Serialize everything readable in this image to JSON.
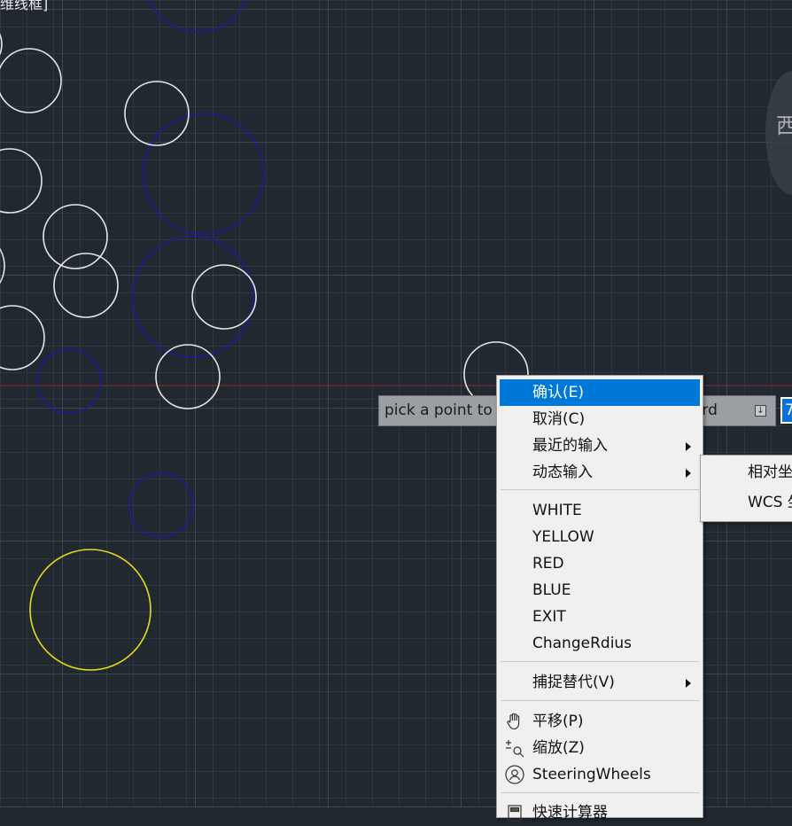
{
  "viewport": {
    "label": "维线框]",
    "viewcube_text": "西"
  },
  "prompt": {
    "text": "pick a point to",
    "tail": "ord",
    "coord_value": "7"
  },
  "colors": {
    "background": "#212830",
    "highlight": "#0078d7",
    "circle_white": "#e6e6e6",
    "circle_blue": "#1c1c9a",
    "circle_yellow": "#e6dc14",
    "crosshair": "#8a2b2b"
  },
  "context_menu": {
    "confirm": "确认(E)",
    "cancel": "取消(C)",
    "recent_input": "最近的输入",
    "dynamic_input": "动态输入",
    "white": "WHITE",
    "yellow": "YELLOW",
    "red": "RED",
    "blue": "BLUE",
    "exit": "EXIT",
    "change_radius": "ChangeRdius",
    "snap_override": "捕捉替代(V)",
    "pan": "平移(P)",
    "zoom": "缩放(Z)",
    "steering_wheels": "SteeringWheels",
    "partial_next": "快速计算器"
  },
  "submenu": {
    "relative": "相对坐",
    "wcs": "WCS 坐"
  },
  "icons": {
    "pan": "hand-icon",
    "zoom": "zoom-icon",
    "steering": "steering-wheel-icon",
    "calculator": "calculator-icon"
  }
}
